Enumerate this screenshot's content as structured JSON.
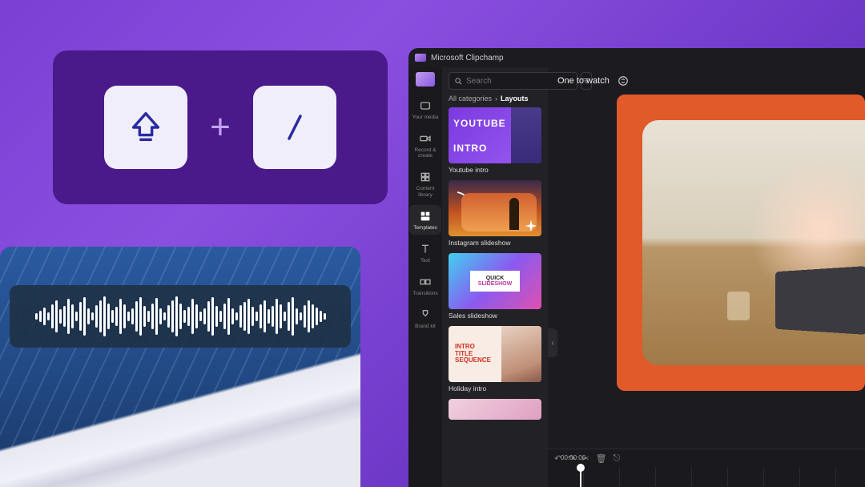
{
  "keycard": {
    "plus": "+"
  },
  "app": {
    "title": "Microsoft Clipchamp",
    "search": {
      "placeholder": "Search"
    },
    "breadcrumb": {
      "root": "All categories",
      "sep": "›",
      "current": "Layouts"
    },
    "preview_title": "One to watch",
    "sidebar": [
      {
        "label": "Your media"
      },
      {
        "label": "Record & create"
      },
      {
        "label": "Content library"
      },
      {
        "label": "Templates"
      },
      {
        "label": "Text"
      },
      {
        "label": "Transitions"
      },
      {
        "label": "Brand kit"
      }
    ],
    "templates": [
      {
        "title": "Youtube intro",
        "label1": "YOUTUBE",
        "label2": "INTRO"
      },
      {
        "title": "Instagram slideshow"
      },
      {
        "title": "Sales slideshow",
        "label1": "QUICK",
        "label2": "SLIDESHOW"
      },
      {
        "title": "Holiday intro",
        "l1": "INTRO",
        "l2": "TITLE",
        "l3": "SEQUENCE"
      }
    ],
    "timeline": {
      "time": "00:00:00"
    }
  }
}
